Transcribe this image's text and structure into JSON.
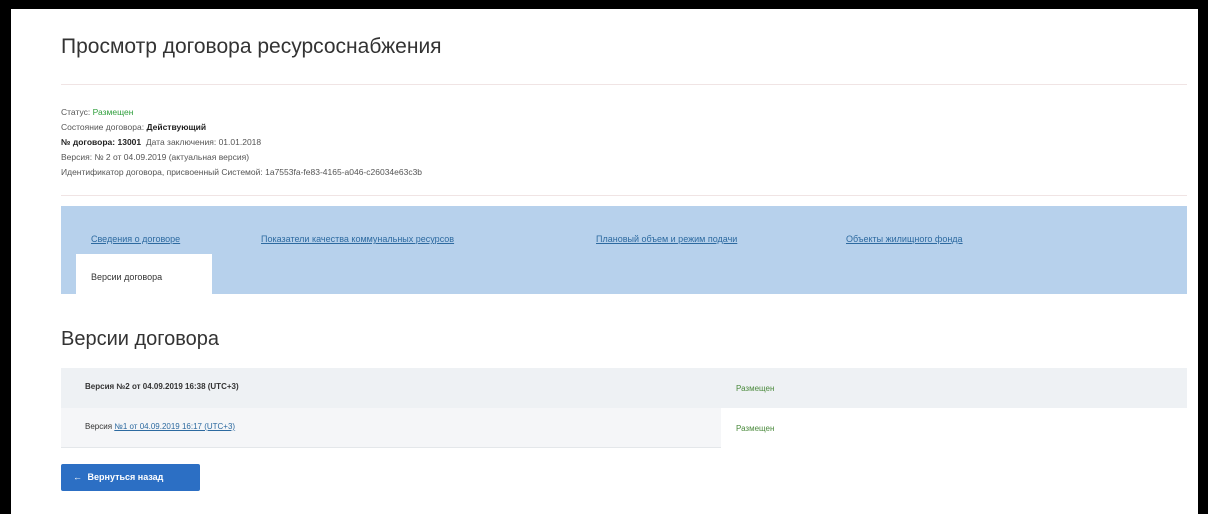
{
  "page": {
    "title": "Просмотр договора ресурсоснабжения"
  },
  "info": {
    "status_label": "Статус:",
    "status_value": "Размещен",
    "state_label": "Состояние договора:",
    "state_value": "Действующий",
    "number_label": "№ договора:",
    "number_value": "13001",
    "date_label": "Дата заключения:",
    "date_value": "01.01.2018",
    "version_text": "Версия: № 2 от 04.09.2019 (актуальная версия)",
    "identifier_label": "Идентификатор договора, присвоенный Системой:",
    "identifier_value": "1a7553fa-fe83-4165-a046-c26034e63c3b"
  },
  "tabs": [
    {
      "label": "Сведения о договоре"
    },
    {
      "label": "Показатели качества коммунальных ресурсов"
    },
    {
      "label": "Плановый объем и режим подачи"
    },
    {
      "label": "Объекты жилищного фонда"
    },
    {
      "label": "Версии договора"
    }
  ],
  "versions": {
    "title": "Версии договора",
    "rows": [
      {
        "prefix": "",
        "text": "Версия №2 от 04.09.2019 16:38 (UTC+3)",
        "status": "Размещен"
      },
      {
        "prefix": "Версия",
        "text": "№1 от 04.09.2019 16:17 (UTC+3)",
        "status": "Размещен"
      }
    ]
  },
  "back_button": {
    "arrow": "←",
    "label": "Вернуться назад"
  },
  "colors": {
    "accent": "#2c6fc4",
    "tab_panel": "#b7d1ec",
    "status_green": "#2e9e3b",
    "link": "#2d6aa0"
  },
  "icons": {
    "back": "arrow-left-icon"
  }
}
